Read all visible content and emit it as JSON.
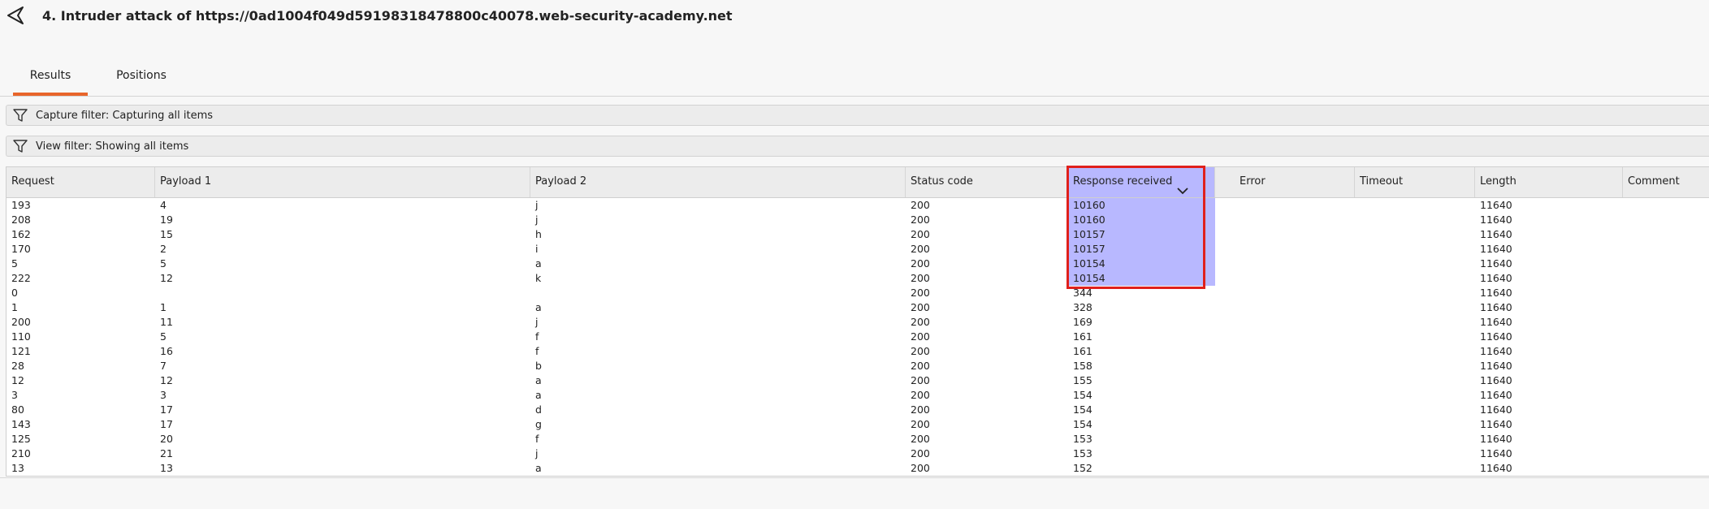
{
  "window": {
    "title": "4. Intruder attack of https://0ad1004f049d59198318478800c40078.web-security-academy.net"
  },
  "tabs": [
    {
      "label": "Results",
      "active": true
    },
    {
      "label": "Positions",
      "active": false
    }
  ],
  "filters": {
    "capture": {
      "label": "Capture filter:",
      "value": "Capturing all items"
    },
    "view": {
      "label": "View filter:",
      "value": "Showing all items"
    }
  },
  "colors": {
    "accent": "#e8652a",
    "sort_highlight": "#b8b8ff",
    "annotation_box": "#e0201c"
  },
  "table": {
    "columns": [
      {
        "key": "request",
        "label": "Request"
      },
      {
        "key": "payload1",
        "label": "Payload 1"
      },
      {
        "key": "payload2",
        "label": "Payload 2"
      },
      {
        "key": "status",
        "label": "Status code"
      },
      {
        "key": "response",
        "label": "Response received",
        "sorted": "desc"
      },
      {
        "key": "error",
        "label": "Error"
      },
      {
        "key": "timeout",
        "label": "Timeout"
      },
      {
        "key": "length",
        "label": "Length"
      },
      {
        "key": "comment",
        "label": "Comment"
      }
    ],
    "rows": [
      {
        "request": "193",
        "payload1": "4",
        "payload2": "j",
        "status": "200",
        "response": "10160",
        "error": "",
        "timeout": "",
        "length": "11640",
        "comment": ""
      },
      {
        "request": "208",
        "payload1": "19",
        "payload2": "j",
        "status": "200",
        "response": "10160",
        "error": "",
        "timeout": "",
        "length": "11640",
        "comment": ""
      },
      {
        "request": "162",
        "payload1": "15",
        "payload2": "h",
        "status": "200",
        "response": "10157",
        "error": "",
        "timeout": "",
        "length": "11640",
        "comment": ""
      },
      {
        "request": "170",
        "payload1": "2",
        "payload2": "i",
        "status": "200",
        "response": "10157",
        "error": "",
        "timeout": "",
        "length": "11640",
        "comment": ""
      },
      {
        "request": "5",
        "payload1": "5",
        "payload2": "a",
        "status": "200",
        "response": "10154",
        "error": "",
        "timeout": "",
        "length": "11640",
        "comment": ""
      },
      {
        "request": "222",
        "payload1": "12",
        "payload2": "k",
        "status": "200",
        "response": "10154",
        "error": "",
        "timeout": "",
        "length": "11640",
        "comment": ""
      },
      {
        "request": "0",
        "payload1": "",
        "payload2": "",
        "status": "200",
        "response": "344",
        "error": "",
        "timeout": "",
        "length": "11640",
        "comment": ""
      },
      {
        "request": "1",
        "payload1": "1",
        "payload2": "a",
        "status": "200",
        "response": "328",
        "error": "",
        "timeout": "",
        "length": "11640",
        "comment": ""
      },
      {
        "request": "200",
        "payload1": "11",
        "payload2": "j",
        "status": "200",
        "response": "169",
        "error": "",
        "timeout": "",
        "length": "11640",
        "comment": ""
      },
      {
        "request": "110",
        "payload1": "5",
        "payload2": "f",
        "status": "200",
        "response": "161",
        "error": "",
        "timeout": "",
        "length": "11640",
        "comment": ""
      },
      {
        "request": "121",
        "payload1": "16",
        "payload2": "f",
        "status": "200",
        "response": "161",
        "error": "",
        "timeout": "",
        "length": "11640",
        "comment": ""
      },
      {
        "request": "28",
        "payload1": "7",
        "payload2": "b",
        "status": "200",
        "response": "158",
        "error": "",
        "timeout": "",
        "length": "11640",
        "comment": ""
      },
      {
        "request": "12",
        "payload1": "12",
        "payload2": "a",
        "status": "200",
        "response": "155",
        "error": "",
        "timeout": "",
        "length": "11640",
        "comment": ""
      },
      {
        "request": "3",
        "payload1": "3",
        "payload2": "a",
        "status": "200",
        "response": "154",
        "error": "",
        "timeout": "",
        "length": "11640",
        "comment": ""
      },
      {
        "request": "80",
        "payload1": "17",
        "payload2": "d",
        "status": "200",
        "response": "154",
        "error": "",
        "timeout": "",
        "length": "11640",
        "comment": ""
      },
      {
        "request": "143",
        "payload1": "17",
        "payload2": "g",
        "status": "200",
        "response": "154",
        "error": "",
        "timeout": "",
        "length": "11640",
        "comment": ""
      },
      {
        "request": "125",
        "payload1": "20",
        "payload2": "f",
        "status": "200",
        "response": "153",
        "error": "",
        "timeout": "",
        "length": "11640",
        "comment": ""
      },
      {
        "request": "210",
        "payload1": "21",
        "payload2": "j",
        "status": "200",
        "response": "153",
        "error": "",
        "timeout": "",
        "length": "11640",
        "comment": ""
      },
      {
        "request": "13",
        "payload1": "13",
        "payload2": "a",
        "status": "200",
        "response": "152",
        "error": "",
        "timeout": "",
        "length": "11640",
        "comment": ""
      }
    ]
  }
}
